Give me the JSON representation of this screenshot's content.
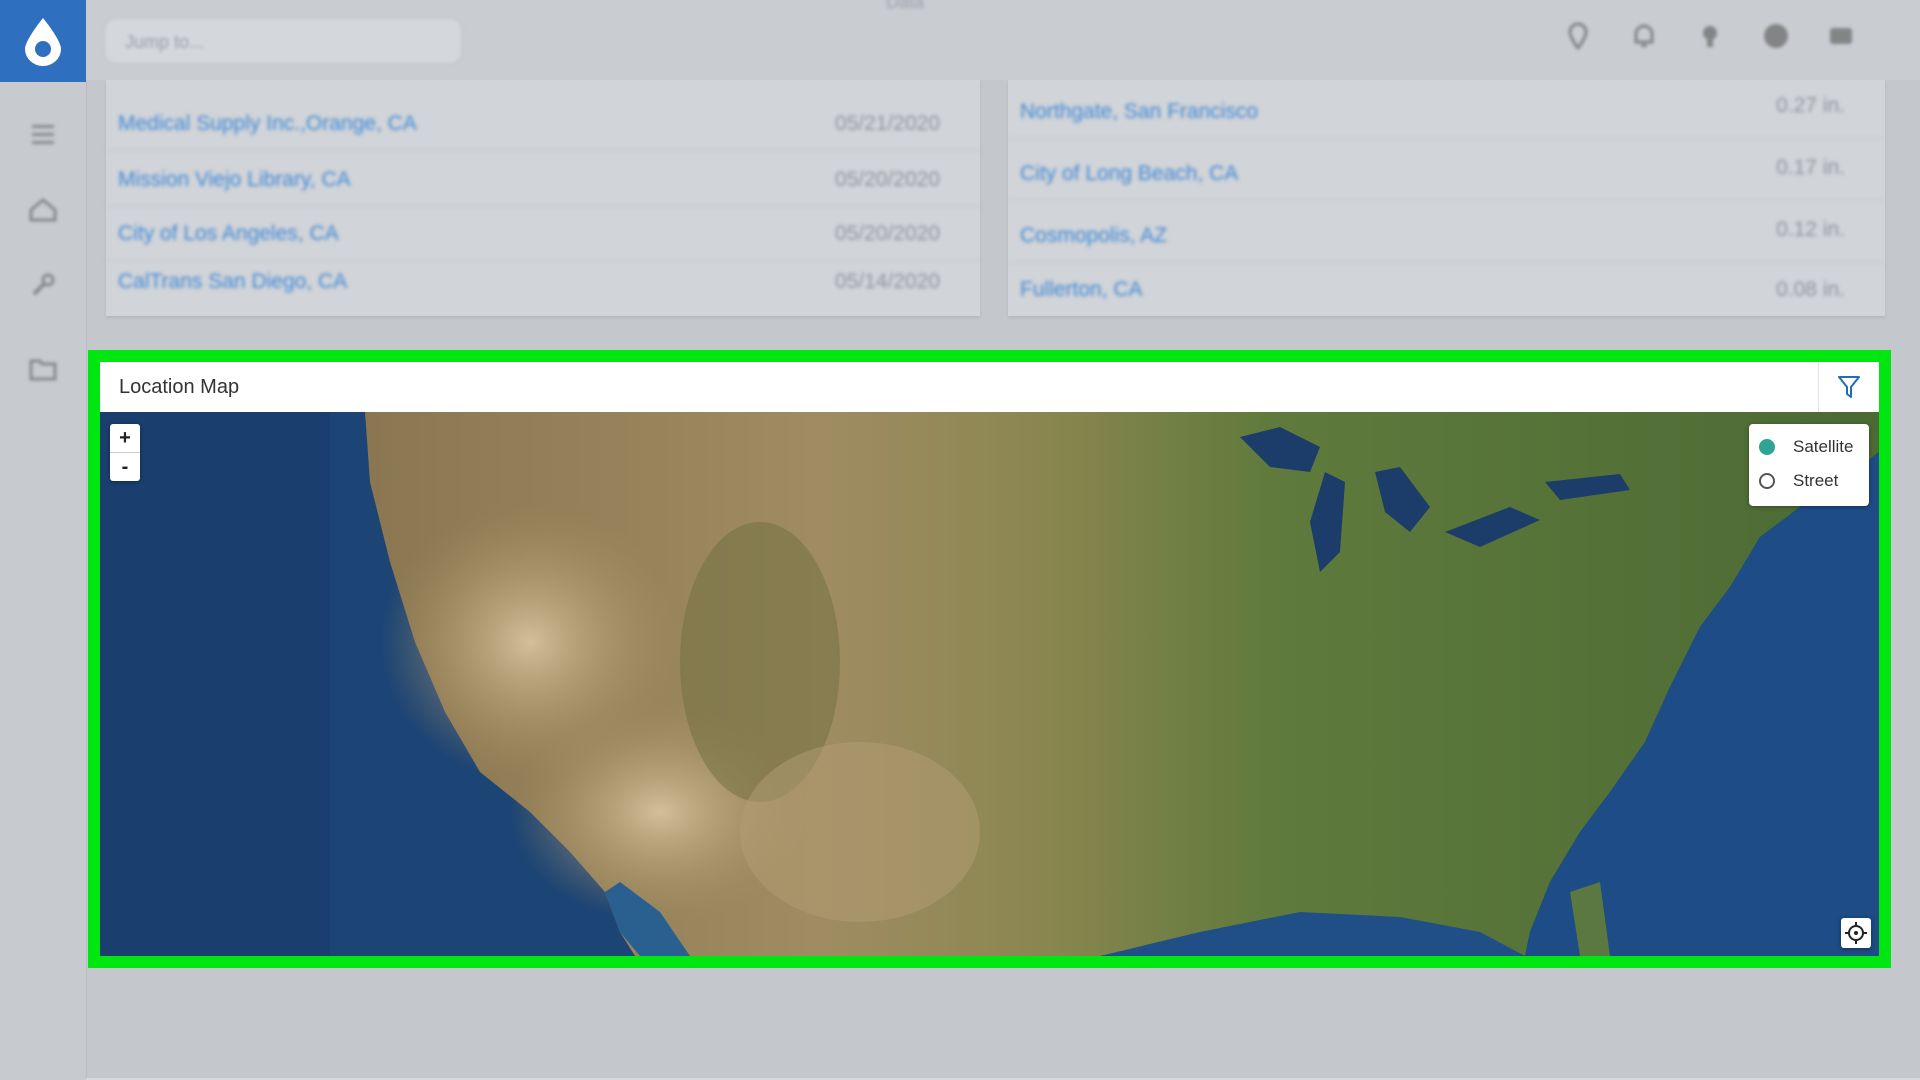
{
  "topbar": {
    "search_placeholder": "Jump to...",
    "title": "Data"
  },
  "left_panel": {
    "rows": [
      {
        "name": "Medical Supply Inc.,Orange, CA",
        "date": "05/21/2020"
      },
      {
        "name": "Mission Viejo Library, CA",
        "date": "05/20/2020"
      },
      {
        "name": "City of Los Angeles, CA",
        "date": "05/20/2020"
      },
      {
        "name": "CalTrans San Diego, CA",
        "date": "05/14/2020"
      }
    ]
  },
  "right_panel": {
    "rows": [
      {
        "name": "Northgate, San Francisco",
        "value": "0.27 in."
      },
      {
        "name": "City of Long Beach, CA",
        "value": "0.17 in."
      },
      {
        "name": "Cosmopolis, AZ",
        "value": "0.12 in."
      },
      {
        "name": "Fullerton, CA",
        "value": "0.08 in."
      }
    ]
  },
  "map": {
    "title": "Location Map",
    "zoom_in": "+",
    "zoom_out": "-",
    "layers": [
      {
        "label": "Satellite",
        "selected": true
      },
      {
        "label": "Street",
        "selected": false
      }
    ],
    "selected_color": "#2fa394",
    "highlight_color": "#00e610"
  },
  "colors": {
    "brand": "#2f6fc0",
    "link": "#3f88d6"
  }
}
